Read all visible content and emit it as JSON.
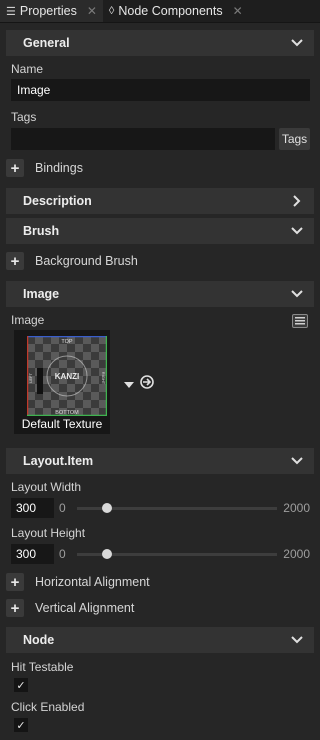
{
  "tabs": [
    {
      "icon": "properties-list-icon",
      "label": "Properties"
    },
    {
      "icon": "node-components-icon",
      "label": "Node Components"
    }
  ],
  "general": {
    "title": "General",
    "name_label": "Name",
    "name_value": "Image",
    "tags_label": "Tags",
    "tags_value": "",
    "tags_button": "Tags",
    "bindings_label": "Bindings"
  },
  "description": {
    "title": "Description"
  },
  "brush": {
    "title": "Brush",
    "background_brush_label": "Background Brush"
  },
  "image": {
    "title": "Image",
    "image_label": "Image",
    "texture_name": "Default Texture"
  },
  "texture_preview": {
    "top": "TOP",
    "bottom": "BOTTOM",
    "left": "LEFT",
    "right": "RIGHT",
    "logo": "KANZI"
  },
  "layout_item": {
    "title": "Layout.Item",
    "width_label": "Layout Width",
    "width_value": "300",
    "width_min": "0",
    "width_max": "2000",
    "width_fraction": 0.15,
    "height_label": "Layout Height",
    "height_value": "300",
    "height_min": "0",
    "height_max": "2000",
    "height_fraction": 0.15,
    "horizontal_alignment_label": "Horizontal Alignment",
    "vertical_alignment_label": "Vertical Alignment"
  },
  "node": {
    "title": "Node",
    "hit_testable_label": "Hit Testable",
    "hit_testable_checked": true,
    "click_enabled_label": "Click Enabled",
    "click_enabled_checked": true
  },
  "colors": {
    "background": "#262626",
    "section": "#333333",
    "input": "#171717",
    "accent_green": "#3fb34f",
    "accent_red": "#c0392b",
    "accent_blue": "#3a5fcd"
  }
}
